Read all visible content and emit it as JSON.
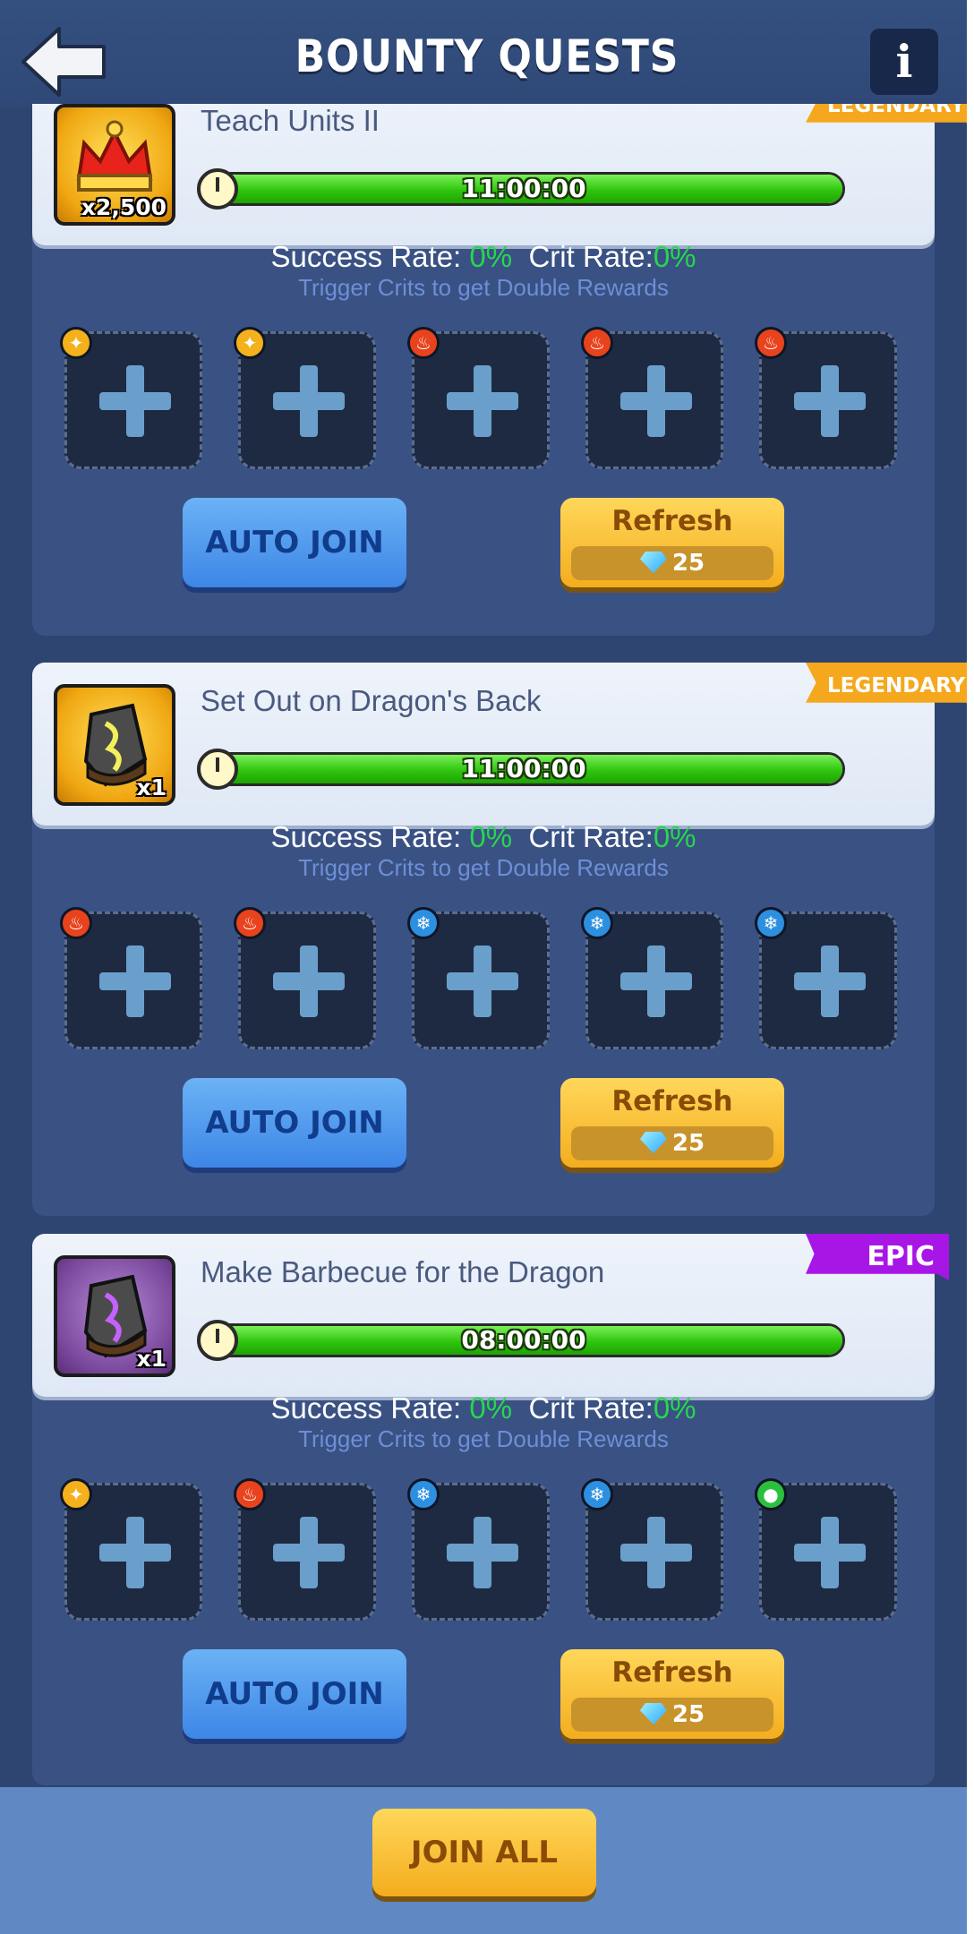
{
  "header": {
    "title": "BOUNTY QUESTS",
    "info_label": "i"
  },
  "quests": [
    {
      "name": "Teach Units II",
      "rarity": "LEGENDARY",
      "reward_icon": "crown-icon",
      "reward_qty": "x2,500",
      "timer": "11:00:00",
      "timer_progress": 1.0,
      "success_label": "Success Rate:",
      "success_rate": "0%",
      "crit_label": "Crit Rate:",
      "crit_rate": "0%",
      "hint": "Trigger Crits to get Double Rewards",
      "slots": [
        "light",
        "light",
        "fire",
        "fire",
        "fire"
      ],
      "auto_join": "AUTO JOIN",
      "refresh": "Refresh",
      "refresh_cost": "25"
    },
    {
      "name": "Set Out on Dragon's Back",
      "rarity": "LEGENDARY",
      "reward_icon": "gold-rune-stone-icon",
      "reward_qty": "x1",
      "timer": "11:00:00",
      "timer_progress": 1.0,
      "success_label": "Success Rate:",
      "success_rate": "0%",
      "crit_label": "Crit Rate:",
      "crit_rate": "0%",
      "hint": "Trigger Crits to get Double Rewards",
      "slots": [
        "fire",
        "fire",
        "ice",
        "ice",
        "ice"
      ],
      "auto_join": "AUTO JOIN",
      "refresh": "Refresh",
      "refresh_cost": "25"
    },
    {
      "name": "Make Barbecue for the Dragon",
      "rarity": "EPIC",
      "reward_icon": "purple-rune-stone-icon",
      "reward_qty": "x1",
      "timer": "08:00:00",
      "timer_progress": 1.0,
      "success_label": "Success Rate:",
      "success_rate": "0%",
      "crit_label": "Crit Rate:",
      "crit_rate": "0%",
      "hint": "Trigger Crits to get Double Rewards",
      "slots": [
        "light",
        "fire",
        "ice",
        "ice",
        "nature"
      ],
      "auto_join": "AUTO JOIN",
      "refresh": "Refresh",
      "refresh_cost": "25"
    }
  ],
  "footer": {
    "join_all": "JOIN ALL"
  },
  "colors": {
    "legendary": "#f5a81d",
    "epic": "#a816e6",
    "rate_green": "#27d64e",
    "hint_blue": "#6d8fd6"
  }
}
